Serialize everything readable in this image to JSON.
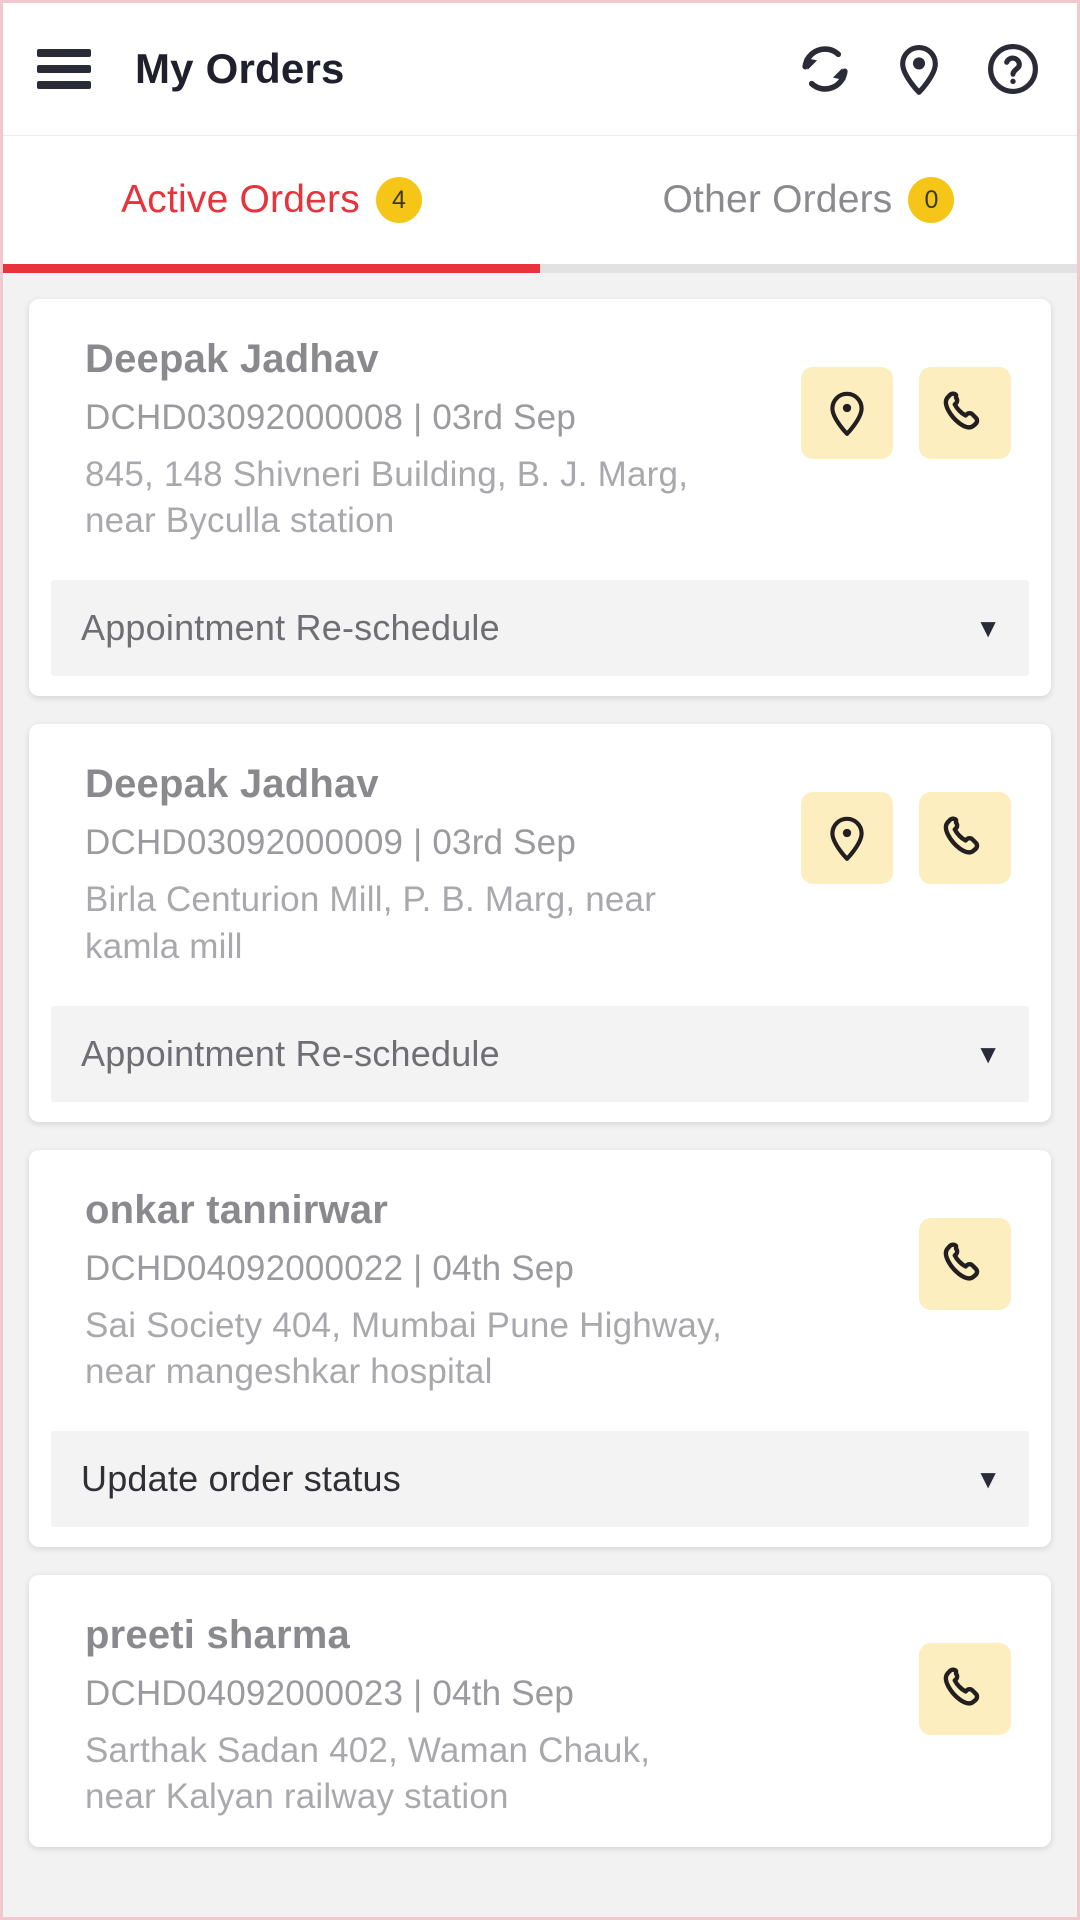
{
  "header": {
    "menu_icon": "hamburger-menu-icon",
    "title": "My Orders",
    "actions": [
      {
        "icon": "sync-refresh-icon"
      },
      {
        "icon": "location-pin-icon"
      },
      {
        "icon": "help-question-icon"
      }
    ]
  },
  "tabs": [
    {
      "label": "Active Orders",
      "badge": "4",
      "active": true
    },
    {
      "label": "Other Orders",
      "badge": "0",
      "active": false
    }
  ],
  "colors": {
    "accent_red": "#e8323c",
    "badge_yellow": "#f5c518",
    "action_button_bg": "#fdeec0",
    "page_background": "#f2f2f2"
  },
  "orders": [
    {
      "customer": "Deepak Jadhav",
      "meta": "DCHD03092000008 | 03rd Sep",
      "address": "845, 148 Shivneri Building, B. J. Marg, near Byculla station",
      "actions": [
        "location-pin-icon",
        "phone-call-icon"
      ],
      "select_label": "Appointment Re-schedule",
      "caret": "▼"
    },
    {
      "customer": "Deepak Jadhav",
      "meta": "DCHD03092000009 | 03rd Sep",
      "address": "Birla Centurion Mill, P. B. Marg, near kamla mill",
      "actions": [
        "location-pin-icon",
        "phone-call-icon"
      ],
      "select_label": "Appointment Re-schedule",
      "caret": "▼"
    },
    {
      "customer": "onkar tannirwar",
      "meta": "DCHD04092000022 | 04th Sep",
      "address": "Sai Society 404, Mumbai Pune Highway, near mangeshkar hospital",
      "actions": [
        "phone-call-icon"
      ],
      "select_label": "Update order status",
      "caret": "▼"
    },
    {
      "customer": "preeti sharma",
      "meta": "DCHD04092000023 | 04th Sep",
      "address": "Sarthak Sadan 402, Waman Chauk, near Kalyan railway station",
      "actions": [
        "phone-call-icon"
      ],
      "select_label": "",
      "caret": ""
    }
  ]
}
